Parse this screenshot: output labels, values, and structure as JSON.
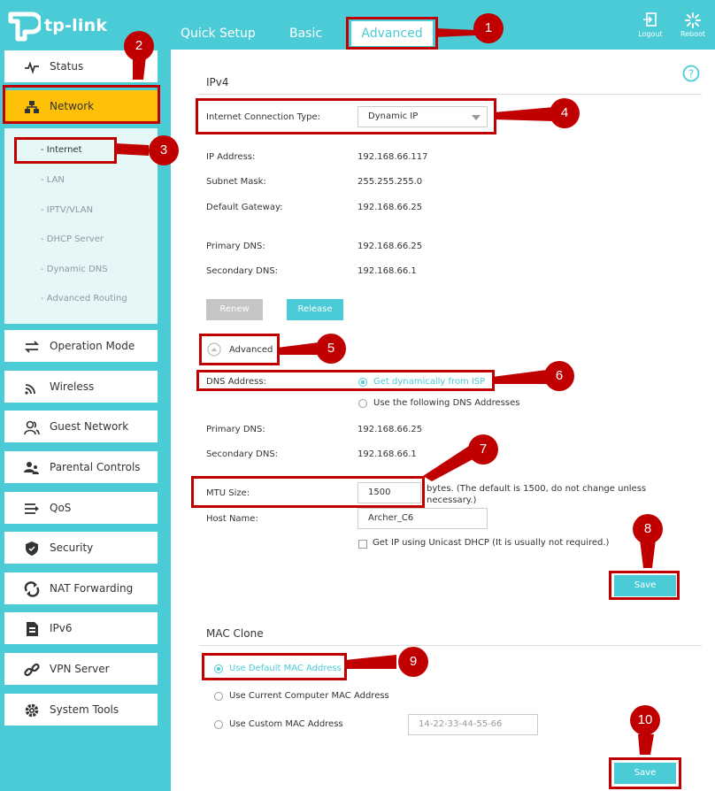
{
  "brand": "tp-link",
  "topnav": {
    "quick_setup": "Quick Setup",
    "basic": "Basic",
    "advanced": "Advanced"
  },
  "tools": {
    "logout": "Logout",
    "reboot": "Reboot"
  },
  "sidebar": {
    "items": [
      {
        "label": "Status",
        "icon": "status-icon"
      },
      {
        "label": "Network",
        "icon": "network-icon",
        "active": true
      },
      {
        "label": "Operation Mode",
        "icon": "operation-mode-icon"
      },
      {
        "label": "Wireless",
        "icon": "wireless-icon"
      },
      {
        "label": "Guest Network",
        "icon": "guest-network-icon"
      },
      {
        "label": "Parental Controls",
        "icon": "parental-controls-icon"
      },
      {
        "label": "QoS",
        "icon": "qos-icon"
      },
      {
        "label": "Security",
        "icon": "security-shield-icon"
      },
      {
        "label": "NAT Forwarding",
        "icon": "nat-forwarding-icon"
      },
      {
        "label": "IPv6",
        "icon": "ipv6-icon"
      },
      {
        "label": "VPN Server",
        "icon": "vpn-link-icon"
      },
      {
        "label": "System Tools",
        "icon": "gear-icon"
      }
    ],
    "network_sub": [
      "- Internet",
      "- LAN",
      "- IPTV/VLAN",
      "- DHCP Server",
      "- Dynamic DNS",
      "- Advanced Routing"
    ]
  },
  "ipv4": {
    "title": "IPv4",
    "conn_type_label": "Internet Connection Type:",
    "conn_type_value": "Dynamic IP",
    "ip_label": "IP Address:",
    "ip_value": "192.168.66.117",
    "mask_label": "Subnet Mask:",
    "mask_value": "255.255.255.0",
    "gw_label": "Default Gateway:",
    "gw_value": "192.168.66.25",
    "pdns_label": "Primary DNS:",
    "pdns_value": "192.168.66.25",
    "sdns_label": "Secondary DNS:",
    "sdns_value": "192.168.66.1",
    "renew": "Renew",
    "release": "Release",
    "advanced": "Advanced",
    "dns_label": "DNS Address:",
    "dns_opt1": "Get dynamically from ISP",
    "dns_opt2": "Use the following DNS Addresses",
    "pdns2_label": "Primary DNS:",
    "pdns2_value": "192.168.66.25",
    "sdns2_label": "Secondary DNS:",
    "sdns2_value": "192.168.66.1",
    "mtu_label": "MTU Size:",
    "mtu_value": "1500",
    "mtu_note": "bytes. (The default is 1500, do not change unless necessary.)",
    "host_label": "Host Name:",
    "host_value": "Archer_C6",
    "unicast": "Get IP using Unicast DHCP (It is usually not required.)",
    "save": "Save"
  },
  "mac": {
    "title": "MAC Clone",
    "opt1": "Use Default MAC Address",
    "opt2": "Use Current Computer MAC Address",
    "opt3": "Use Custom MAC Address",
    "custom_placeholder": "14-22-33-44-55-66",
    "save": "Save"
  },
  "callouts": [
    "1",
    "2",
    "3",
    "4",
    "5",
    "6",
    "7",
    "8",
    "9",
    "10"
  ],
  "colors": {
    "accent": "#4acbd6",
    "active": "#ffc107",
    "annotation": "#c00000"
  }
}
